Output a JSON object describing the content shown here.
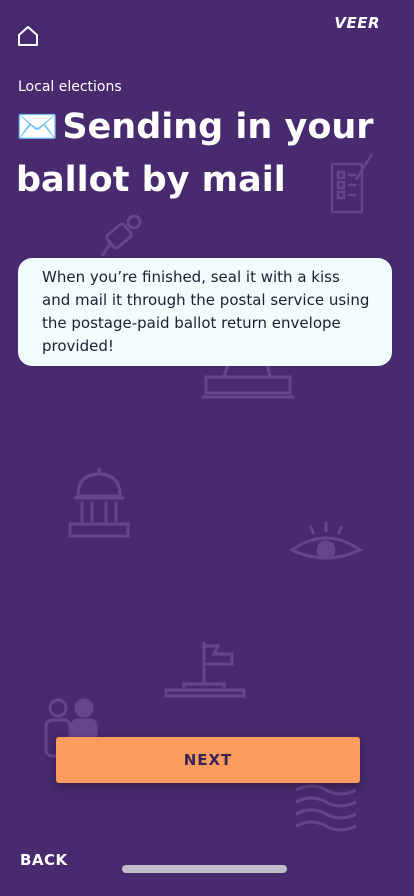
{
  "header": {
    "home_icon": "home-icon",
    "brand": "VEER"
  },
  "main": {
    "section_label": "Local elections",
    "title_emoji": "✉️",
    "title": "Sending in your ballot by mail",
    "message": "When you’re finished, seal it with a kiss and mail it through the postal service using the postage-paid ballot return envelope provided!"
  },
  "footer": {
    "next_label": "NEXT",
    "back_label": "BACK"
  },
  "background_icons": [
    "clipboard-icon",
    "microphone-icon",
    "ballot-box-icon",
    "capitol-icon",
    "eye-icon",
    "podium-flag-icon",
    "people-icon",
    "flag-icon"
  ],
  "colors": {
    "background": "#482a6f",
    "card": "#f1fcfd",
    "accent": "#fb9c5e",
    "icon_line": "#7d5ca6"
  }
}
